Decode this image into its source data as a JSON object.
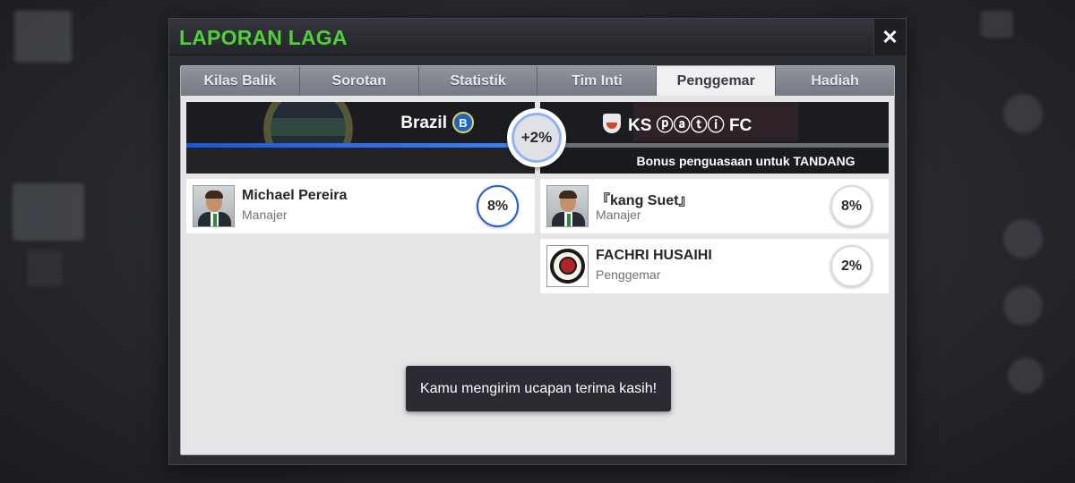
{
  "dialog": {
    "title": "LAPORAN LAGA",
    "close_icon": "close-icon"
  },
  "tabs": [
    {
      "label": "Kilas Balik",
      "active": false
    },
    {
      "label": "Sorotan",
      "active": false
    },
    {
      "label": "Statistik",
      "active": false
    },
    {
      "label": "Tim Inti",
      "active": false
    },
    {
      "label": "Penggemar",
      "active": true
    },
    {
      "label": "Hadiah",
      "active": false
    }
  ],
  "home_team": {
    "name": "Brazil",
    "badge_icon": "club-badge-icon",
    "progress_percent": 100,
    "accent_color": "#1a56d9"
  },
  "away_team": {
    "name": "KS ⓟⓐⓣⓘ FC",
    "badge_icon": "club-shield-icon",
    "bonus_text": "Bonus penguasaan untuk TANDANG"
  },
  "possession_bonus": "+2%",
  "home_contributors": [
    {
      "name": "Michael Pereira",
      "role": "Manajer",
      "percent": "8%",
      "avatar": "manager-avatar"
    }
  ],
  "away_contributors": [
    {
      "name": "『kang Suet』",
      "role": "Manajer",
      "percent": "8%",
      "avatar": "manager-avatar"
    },
    {
      "name": "FACHRI HUSAIHI",
      "role": "Penggemar",
      "percent": "2%",
      "avatar": "emblem-avatar"
    }
  ],
  "toast": "Kamu mengirim ucapan terima kasih!",
  "colors": {
    "title": "#4fd13a",
    "panel": "#e4e5e7",
    "home_ring": "#1f5fd0"
  }
}
